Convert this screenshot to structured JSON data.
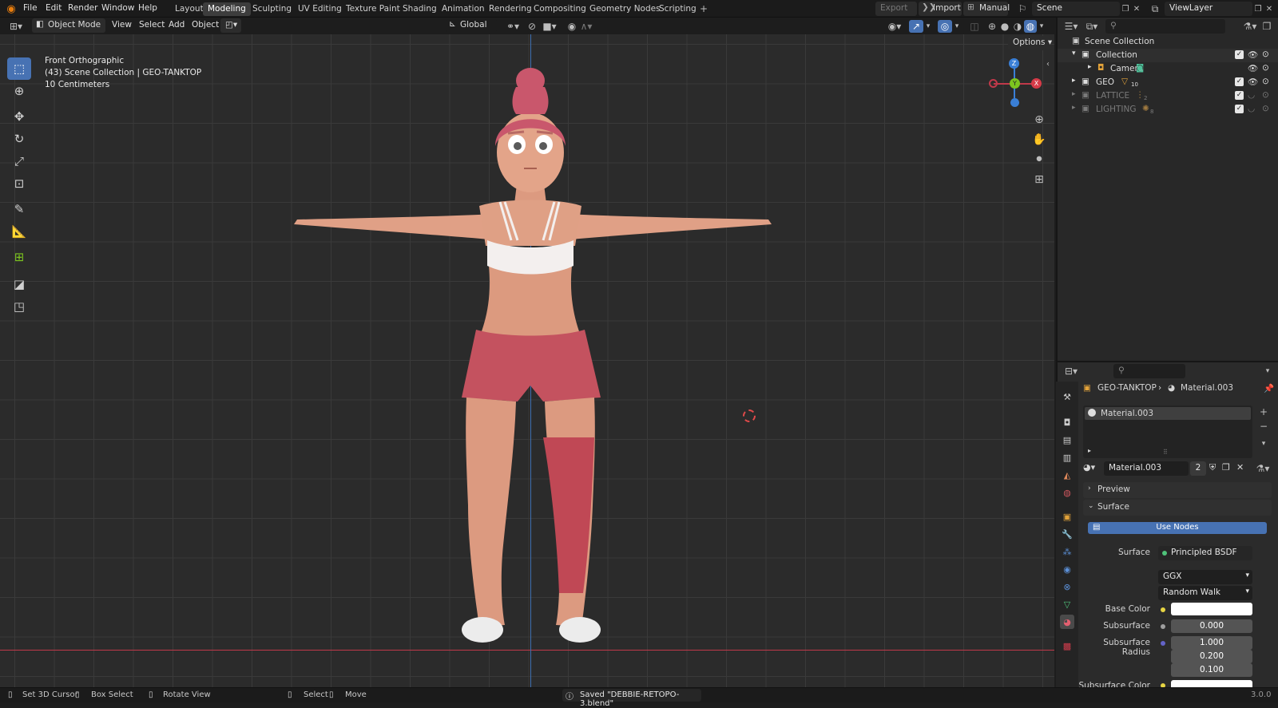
{
  "topbar": {
    "menus": [
      "File",
      "Edit",
      "Render",
      "Window",
      "Help"
    ],
    "workspaces": [
      "Layout",
      "Modeling",
      "Sculpting",
      "UV Editing",
      "Texture Paint",
      "Shading",
      "Animation",
      "Rendering",
      "Compositing",
      "Geometry Nodes",
      "Scripting"
    ],
    "active_workspace": "Modeling",
    "export_label": "Export",
    "import_label": "Import",
    "manual_label": "Manual",
    "scene_name": "Scene",
    "view_layer": "ViewLayer"
  },
  "viewport_header": {
    "mode": "Object Mode",
    "menus": [
      "View",
      "Select",
      "Add",
      "Object"
    ],
    "transform_orientation": "Global",
    "options_label": "Options"
  },
  "viewport": {
    "view_name": "Front Orthographic",
    "collection_info": "(43) Scene Collection | GEO-TANKTOP",
    "grid_scale": "10 Centimeters",
    "gizmo_axes": {
      "z": "Z",
      "y": "Y",
      "x": "X"
    }
  },
  "outliner": {
    "root": "Scene Collection",
    "items": [
      {
        "name": "Collection",
        "expanded": true
      },
      {
        "name": "Camera",
        "child": true
      },
      {
        "name": "GEO",
        "badge": "10"
      },
      {
        "name": "LATTICE",
        "badge": "2",
        "dim": true
      },
      {
        "name": "LIGHTING",
        "badge": "8",
        "dim": true
      }
    ]
  },
  "properties": {
    "breadcrumb_object": "GEO-TANKTOP",
    "breadcrumb_material": "Material.003",
    "slot_name": "Material.003",
    "material_name": "Material.003",
    "user_count": "2",
    "preview_label": "Preview",
    "surface_label": "Surface",
    "use_nodes_label": "Use Nodes",
    "surface_field_label": "Surface",
    "surface_shader": "Principled BSDF",
    "distribution": "GGX",
    "subsurface_method": "Random Walk",
    "base_color_label": "Base Color",
    "subsurface_label": "Subsurface",
    "subsurface_value": "0.000",
    "subsurface_radius_label": "Subsurface Radius",
    "subsurface_radius": [
      "1.000",
      "0.200",
      "0.100"
    ],
    "subsurface_color_label": "Subsurface Color"
  },
  "statusbar": {
    "items": [
      "Set 3D Cursor",
      "Box Select",
      "Rotate View",
      "Select",
      "Move"
    ],
    "message": "Saved \"DEBBIE-RETOPO-3.blend\"",
    "version": "3.0.0"
  },
  "colors": {
    "accent": "#4772b3",
    "x_axis": "#d63b48",
    "y_axis": "#7cc41f",
    "z_axis": "#3a7fd6"
  }
}
